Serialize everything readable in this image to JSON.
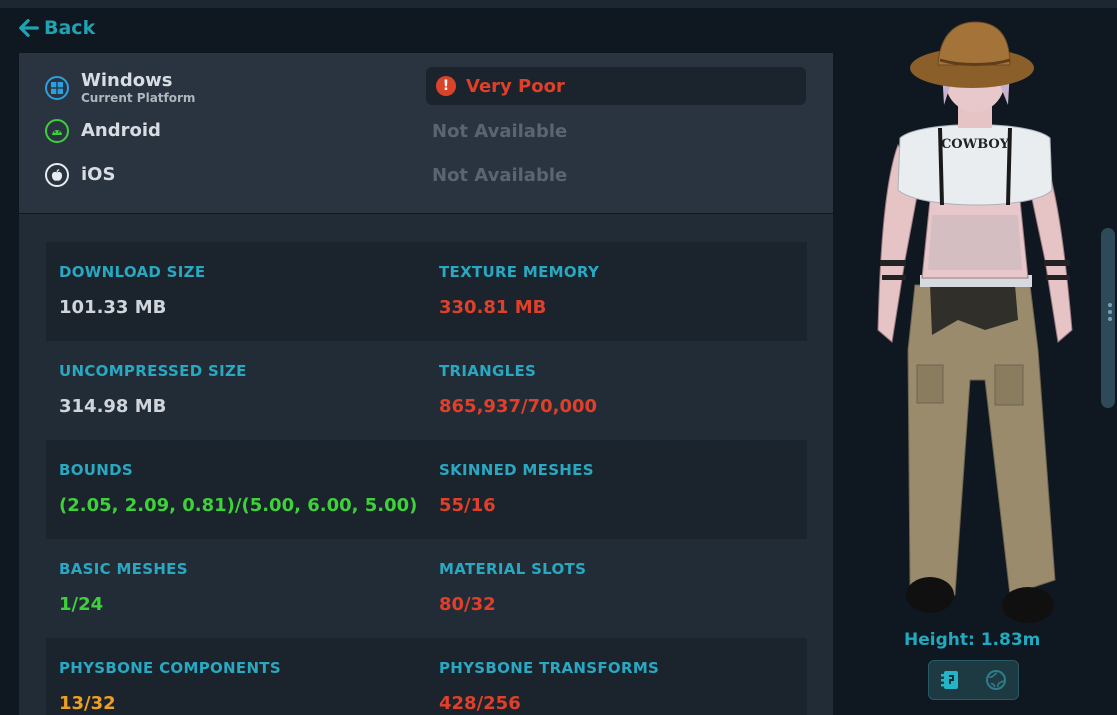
{
  "nav": {
    "back_label": "Back"
  },
  "platforms": [
    {
      "name": "Windows",
      "subtitle": "Current Platform",
      "rating": "Very Poor",
      "icon": "windows-icon"
    },
    {
      "name": "Android",
      "rating": "Not Available",
      "icon": "android-icon"
    },
    {
      "name": "iOS",
      "rating": "Not Available",
      "icon": "apple-icon"
    }
  ],
  "stats": [
    {
      "left": {
        "label": "DOWNLOAD SIZE",
        "value": "101.33 MB",
        "color": "#cfd5db"
      },
      "right": {
        "label": "TEXTURE MEMORY",
        "value": "330.81 MB",
        "color": "#e0402a"
      }
    },
    {
      "left": {
        "label": "UNCOMPRESSED SIZE",
        "value": "314.98 MB",
        "color": "#cfd5db"
      },
      "right": {
        "label": "TRIANGLES",
        "value": "865,937/70,000",
        "color": "#e0402a"
      }
    },
    {
      "left": {
        "label": "BOUNDS",
        "value": "(2.05, 2.09, 0.81)/(5.00, 6.00, 5.00)",
        "color": "#3ed23a"
      },
      "right": {
        "label": "SKINNED MESHES",
        "value": "55/16",
        "color": "#e0402a"
      }
    },
    {
      "left": {
        "label": "BASIC MESHES",
        "value": "1/24",
        "color": "#3ed23a"
      },
      "right": {
        "label": "MATERIAL SLOTS",
        "value": "80/32",
        "color": "#e0402a"
      }
    },
    {
      "left": {
        "label": "PHYSBONE COMPONENTS",
        "value": "13/32",
        "color": "#f0a020"
      },
      "right": {
        "label": "PHYSBONE TRANSFORMS",
        "value": "428/256",
        "color": "#e0402a"
      }
    }
  ],
  "avatar": {
    "shirt_text": "COWBOY",
    "height_label": "Height: 1.83m"
  },
  "colors": {
    "accent": "#1fa3b3",
    "very_poor": "#e0402a",
    "good": "#3ed23a",
    "medium": "#f0a020"
  }
}
